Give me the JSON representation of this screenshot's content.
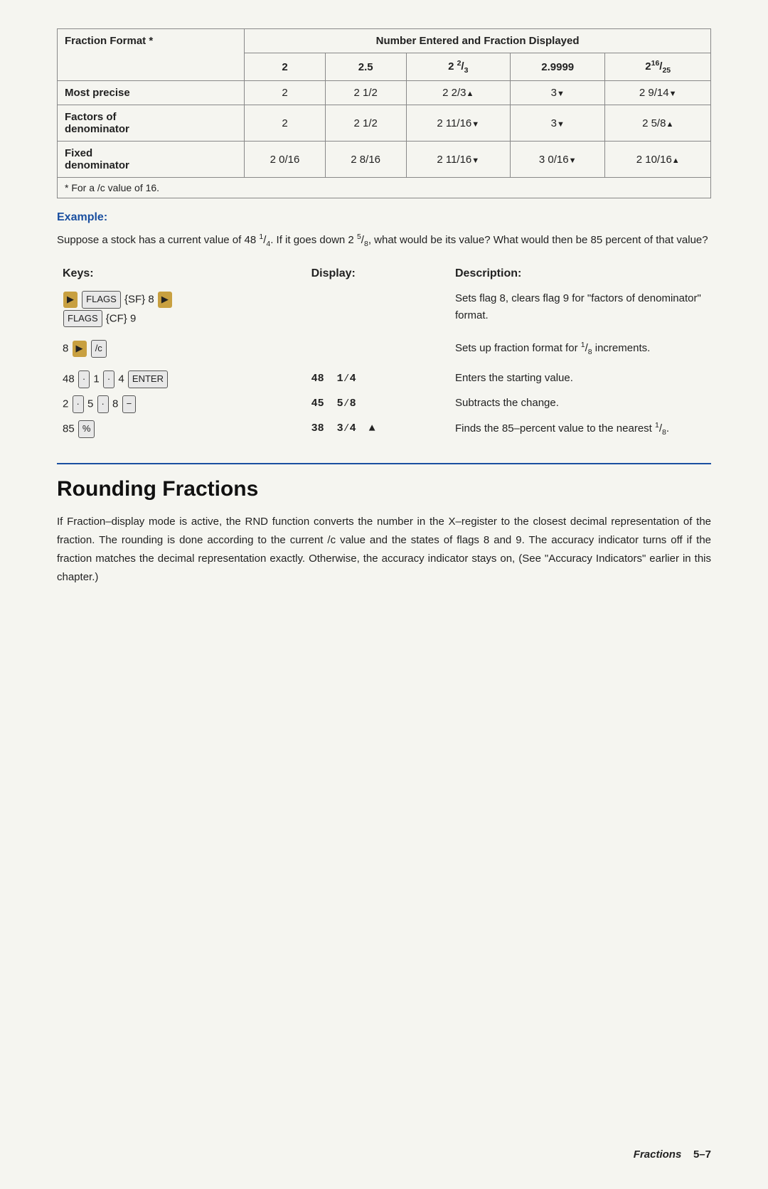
{
  "table": {
    "col1_header": "Fraction Format *",
    "col_group_header": "Number Entered and Fraction Displayed",
    "col_values": [
      "2",
      "2.5",
      "2 2/3",
      "2.9999",
      "2¹⁶/₂₅"
    ],
    "rows": [
      {
        "label": "Most precise",
        "cells": [
          "2",
          "2 1/2",
          "2 2/3▲",
          "3▼",
          "2 9/14▼"
        ]
      },
      {
        "label": "Factors of denominator",
        "cells": [
          "2",
          "2 1/2",
          "2 11/16▼",
          "3▼",
          "2 5/8▲"
        ]
      },
      {
        "label": "Fixed denominator",
        "cells": [
          "2 0/16",
          "2 8/16",
          "2 11/16▼",
          "3 0/16▼",
          "2 10/16▲"
        ]
      }
    ],
    "footnote": "* For a /c value of 16."
  },
  "example": {
    "label": "Example:",
    "text": "Suppose a stock has a current value of 48 ¹/₄. If it goes down 2 ⁵/₈, what would be its value? What would then be 85 percent of that value?"
  },
  "kdd": {
    "col_keys": "Keys:",
    "col_display": "Display:",
    "col_desc": "Description:",
    "rows": [
      {
        "keys": "▶ FLAGS {SF} 8 ▶\nFLAGS {CF} 9",
        "display": "",
        "desc": "Sets flag 8, clears flag 9 for \"factors of denominator\" format."
      },
      {
        "keys": "8 ▶ /c",
        "display": "",
        "desc": "Sets up fraction format for ¹/₈ increments."
      },
      {
        "keys": "48 · 1 · 4 ENTER",
        "display": "48  1⁄4",
        "desc": "Enters the starting value."
      },
      {
        "keys": "2 · 5 · 8 −",
        "display": "45  5⁄8",
        "desc": "Subtracts the change."
      },
      {
        "keys": "85 %",
        "display": "38  3⁄4  ▲",
        "desc": "Finds the 85–percent value to the nearest ¹/₈."
      }
    ]
  },
  "rounding": {
    "title": "Rounding Fractions",
    "body": "If Fraction–display mode is active, the RND function converts the number in the X–register to the closest decimal representation of the fraction. The rounding is done according to the current /c value and the states of flags 8 and 9. The accuracy indicator turns off if the fraction matches the decimal representation exactly. Otherwise, the accuracy indicator stays on, (See \"Accuracy Indicators\" earlier in this chapter.)"
  },
  "footer": {
    "label": "Fractions",
    "page": "5–7"
  }
}
